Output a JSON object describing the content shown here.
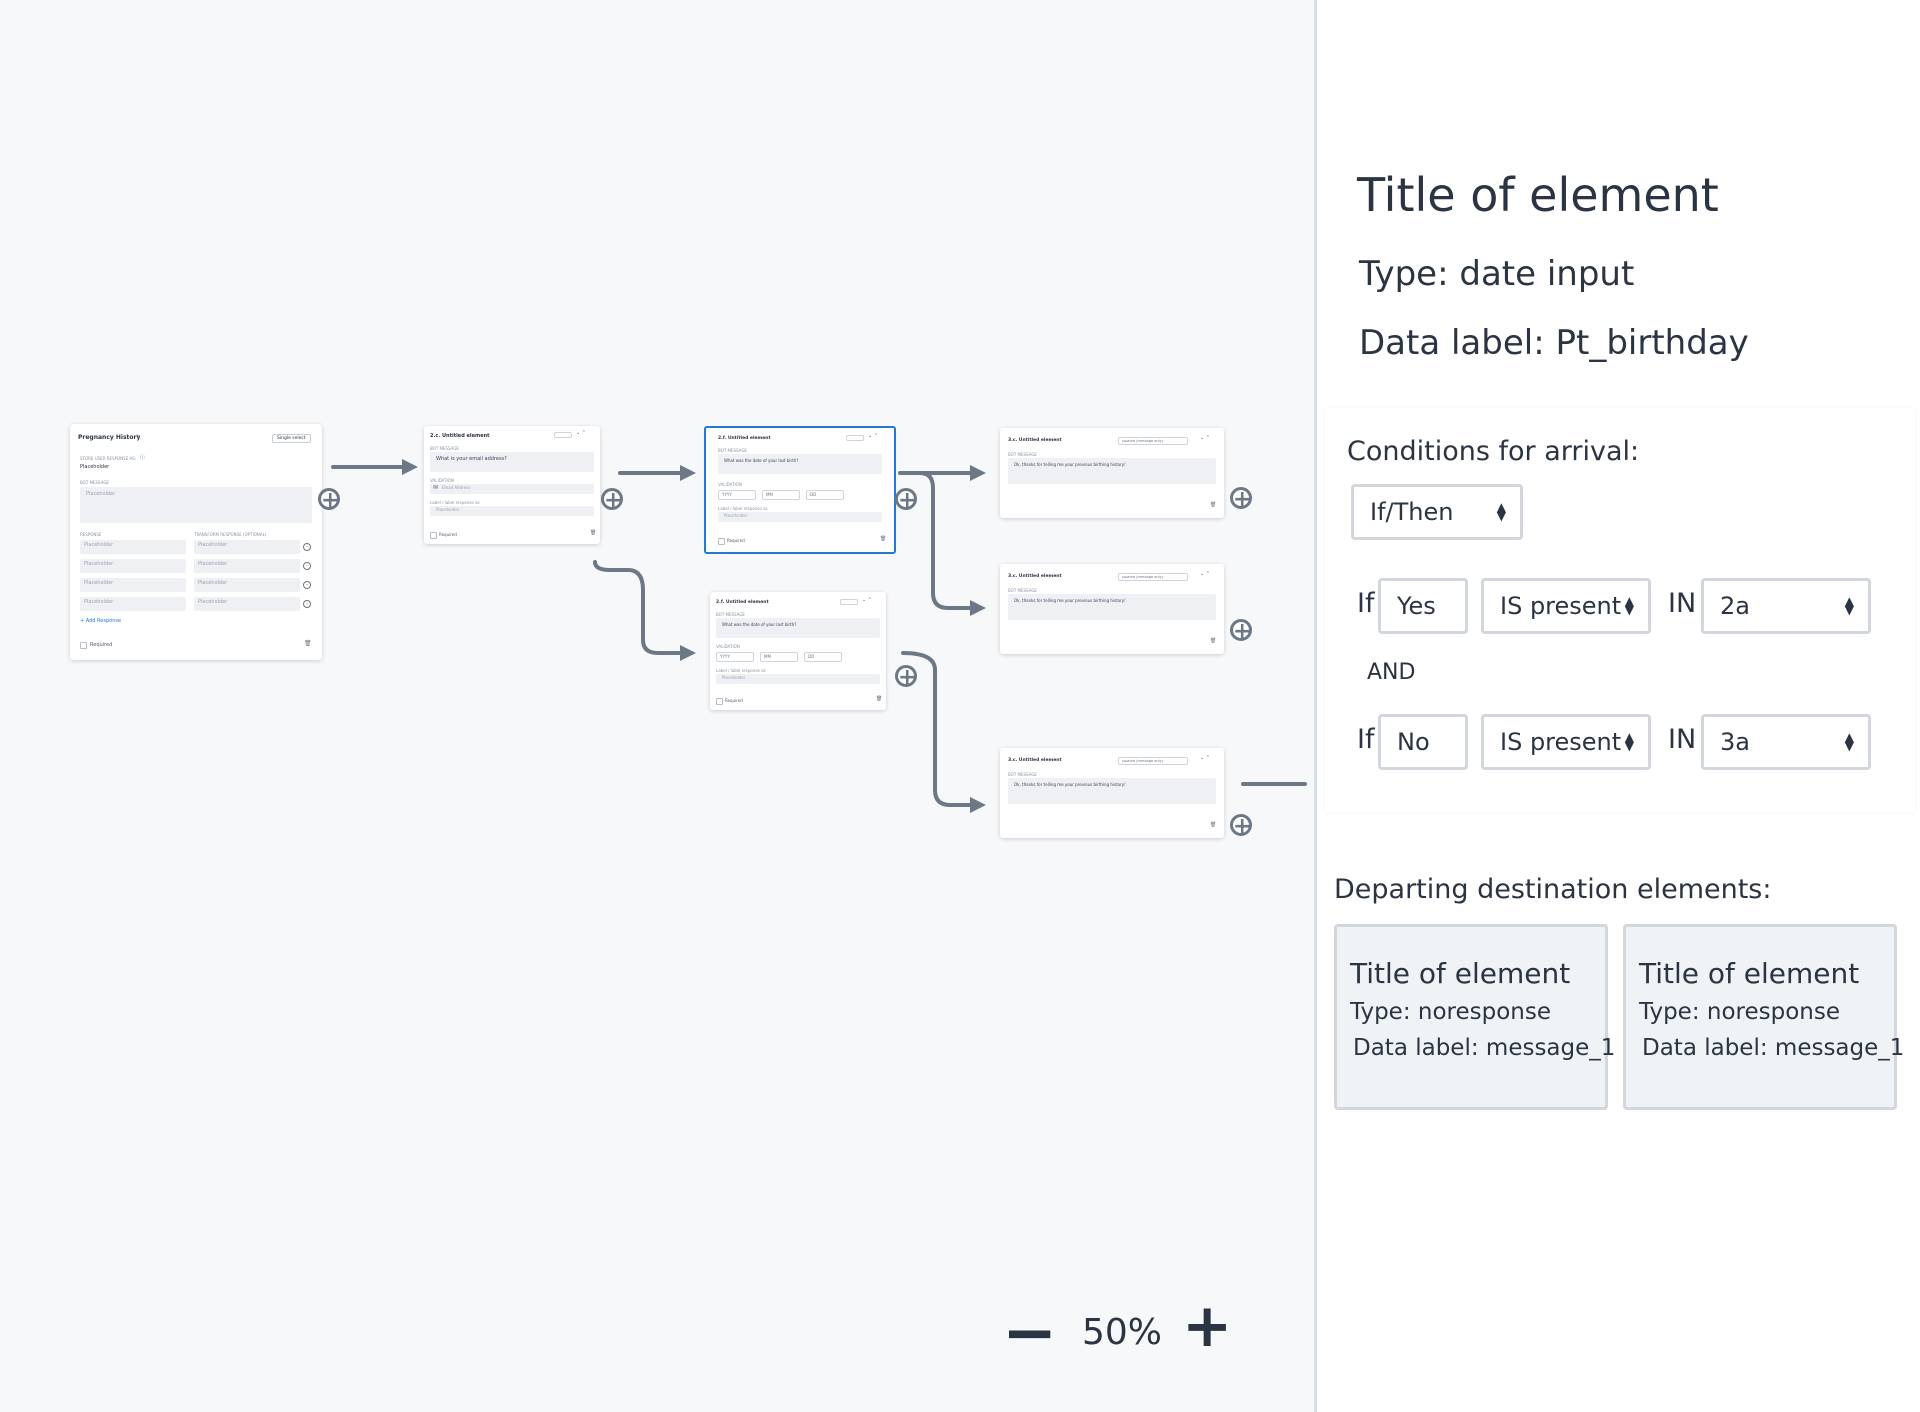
{
  "canvas": {
    "card1": {
      "title": "Pregnancy History",
      "badge": "Single select",
      "store_label": "STORE USER RESPONSE AS:",
      "store_value": "Placeholder",
      "bot_message_label": "BOT MESSAGE",
      "bot_message": "Placeholder",
      "response_label": "RESPONSE",
      "transform_label": "TRANSFORM RESPONSE (OPTIONAL)",
      "responses": [
        "Placeholder",
        "Placeholder",
        "Placeholder",
        "Placeholder"
      ],
      "transforms": [
        "Placeholder",
        "Placeholder",
        "Placeholder",
        "Placeholder"
      ],
      "add_response": "+ Add Response",
      "required": "Required"
    },
    "card2": {
      "title": "2.c. Untitled element",
      "bot_label": "BOT MESSAGE",
      "bot_message": "What is your email address?",
      "validation_label": "VALIDATION",
      "email_ph": "Email Address",
      "label_as": "Label / label response as",
      "label_ph": "Placeholder",
      "required": "Required"
    },
    "card3": {
      "title": "2.f. Untitled element",
      "bot_label": "BOT MESSAGE",
      "bot_message": "What was the date of your last birth?",
      "validation_label": "VALIDATION",
      "yyyy": "YYYY",
      "mm": "MM",
      "dd": "DD",
      "label_as": "Label / label response as",
      "label_ph": "Placeholder",
      "required": "Required"
    },
    "card4": {
      "title": "2.f. Untitled element",
      "bot_label": "BOT MESSAGE",
      "bot_message": "What was the date of your last birth?",
      "validation_label": "VALIDATION",
      "yyyy": "YYYY",
      "mm": "MM",
      "dd": "DD",
      "label_as": "Label / label response as",
      "label_ph": "Placeholder",
      "required": "Required"
    },
    "msg_cards": [
      {
        "title": "3.c. Untitled element",
        "type_select": "(sparse (message only)",
        "bot_label": "BOT MESSAGE",
        "message": "Ok, thanks for telling me your previous birthing history!"
      },
      {
        "title": "3.c. Untitled element",
        "type_select": "(sparse (message only)",
        "bot_label": "BOT MESSAGE",
        "message": "Ok, thanks for telling me your previous birthing history!"
      },
      {
        "title": "3.c. Untitled element",
        "type_select": "(sparse (message only)",
        "bot_label": "BOT MESSAGE",
        "message": "Ok, thanks for telling me your previous birthing history!"
      }
    ],
    "zoom": {
      "minus": "−",
      "level": "50%",
      "plus": "+"
    },
    "colors": {
      "wire": "#6c7886",
      "selected_border": "#2479d8"
    }
  },
  "panel": {
    "title": "Title of element",
    "type": "Type: date input",
    "data_label": "Data label: Pt_birthday",
    "conditions": {
      "heading": "Conditions for arrival:",
      "mode": "If/Then",
      "rows": [
        {
          "if": "If",
          "value": "Yes",
          "operator": "IS present",
          "in": "IN",
          "target": "2a"
        },
        {
          "if": "If",
          "value": "No",
          "operator": "IS present",
          "in": "IN",
          "target": "3a"
        }
      ],
      "joiner": "AND"
    },
    "departing": {
      "heading": "Departing destination  elements:",
      "items": [
        {
          "title": "Title of element",
          "type": "Type: noresponse",
          "data_label": "Data label: message_1"
        },
        {
          "title": "Title of element",
          "type": "Type: noresponse",
          "data_label": "Data label: message_1"
        }
      ]
    }
  }
}
